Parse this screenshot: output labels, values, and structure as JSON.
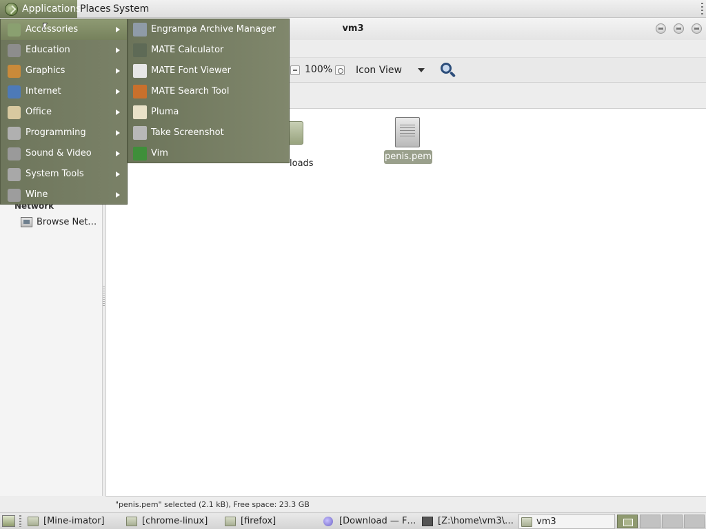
{
  "top_panel": {
    "applications_label": "Applications",
    "places_label": "Places",
    "system_label": "System"
  },
  "window": {
    "title": "vm3",
    "zoom_level": "100%",
    "view_mode": "Icon View",
    "sidebar": {
      "network_heading": "Network",
      "browse_network_label": "Browse Net…"
    },
    "files": [
      {
        "name": "loads",
        "icon": "folder-icon",
        "selected": false
      },
      {
        "name": "penis.pem",
        "icon": "document-icon",
        "selected": true
      }
    ],
    "status_text": "\"penis.pem\" selected (2.1 kB), Free space: 23.3 GB"
  },
  "apps_menu": {
    "categories": [
      {
        "label": "Accessories",
        "icon": "accessories-icon",
        "color": "#8aa070",
        "active": true
      },
      {
        "label": "Education",
        "icon": "education-icon",
        "color": "#8d8d8d"
      },
      {
        "label": "Graphics",
        "icon": "graphics-icon",
        "color": "#c98a3a"
      },
      {
        "label": "Internet",
        "icon": "globe-icon",
        "color": "#4d7ab8"
      },
      {
        "label": "Office",
        "icon": "office-icon",
        "color": "#d8c9a0"
      },
      {
        "label": "Programming",
        "icon": "programming-icon",
        "color": "#b0b0b0"
      },
      {
        "label": "Sound & Video",
        "icon": "sound-video-icon",
        "color": "#9a9a9a"
      },
      {
        "label": "System Tools",
        "icon": "system-tools-icon",
        "color": "#a8a8a8"
      },
      {
        "label": "Wine",
        "icon": "wine-icon",
        "color": "#9d9d9d"
      }
    ],
    "accessories_items": [
      {
        "label": "Engrampa Archive Manager",
        "icon": "archive-icon",
        "color": "#8f9ba8"
      },
      {
        "label": "MATE Calculator",
        "icon": "calculator-icon",
        "color": "#5e6a56"
      },
      {
        "label": "MATE Font Viewer",
        "icon": "font-viewer-icon",
        "color": "#e7e7e7"
      },
      {
        "label": "MATE Search Tool",
        "icon": "search-tool-icon",
        "color": "#c9702c"
      },
      {
        "label": "Pluma",
        "icon": "text-editor-icon",
        "color": "#e9e2c8"
      },
      {
        "label": "Take Screenshot",
        "icon": "screenshot-icon",
        "color": "#b8b8b8"
      },
      {
        "label": "Vim",
        "icon": "vim-icon",
        "color": "#3f8f3a"
      }
    ]
  },
  "taskbar": {
    "tasks": [
      {
        "label": "[Mine-imator]",
        "icon": "folder-icon"
      },
      {
        "label": "[chrome-linux]",
        "icon": "folder-icon"
      },
      {
        "label": "[firefox]",
        "icon": "folder-icon"
      },
      {
        "label": "[Download — F…",
        "icon": "firefox-icon"
      },
      {
        "label": "[Z:\\home\\vm3\\…",
        "icon": "terminal-icon"
      },
      {
        "label": "vm3",
        "icon": "folder-icon",
        "active": true
      }
    ]
  }
}
